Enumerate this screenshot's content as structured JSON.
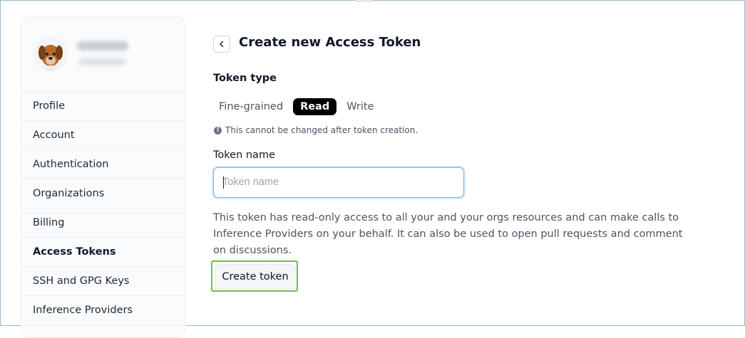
{
  "sidebar": {
    "items": [
      {
        "label": "Profile"
      },
      {
        "label": "Account"
      },
      {
        "label": "Authentication"
      },
      {
        "label": "Organizations"
      },
      {
        "label": "Billing"
      },
      {
        "label": "Access Tokens",
        "active": true
      },
      {
        "label": "SSH and GPG Keys"
      },
      {
        "label": "Inference Providers"
      }
    ]
  },
  "main": {
    "title": "Create new Access Token",
    "back_icon": "chevron-left-icon",
    "token_type_label": "Token type",
    "tabs": [
      {
        "label": "Fine-grained"
      },
      {
        "label": "Read",
        "selected": true
      },
      {
        "label": "Write"
      }
    ],
    "hint_text": "This cannot be changed after token creation.",
    "hint_icon": "info-icon",
    "token_name_label": "Token name",
    "token_name_placeholder": "Token name",
    "token_name_value": "",
    "description": "This token has read-only access to all your and your orgs resources and can make calls to Inference Providers on your behalf. It can also be used to open pull requests and comment on discussions.",
    "create_button_label": "Create token"
  },
  "colors": {
    "selected_tab_bg": "#000000",
    "highlight_border": "#6bbf4a",
    "input_focus_border": "#7fb3e6"
  }
}
